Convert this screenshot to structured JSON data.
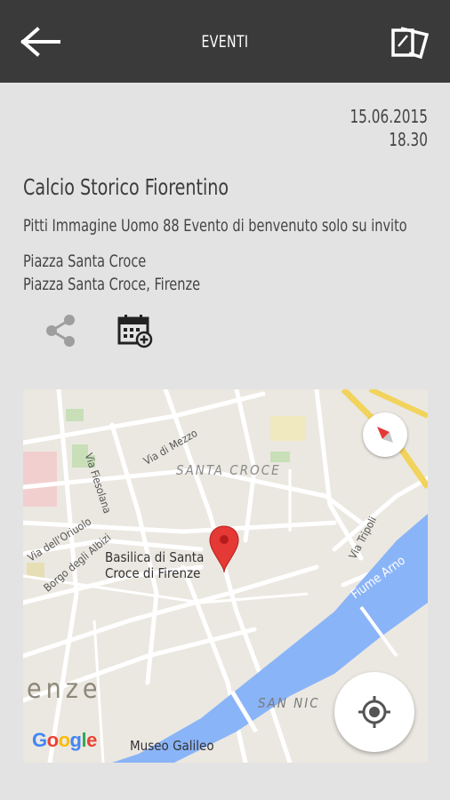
{
  "header": {
    "title": "EVENTI",
    "back_icon": "arrow-left-icon",
    "tickets_icon": "tickets-icon"
  },
  "event": {
    "date": "15.06.2015",
    "time": "18.30",
    "title": "Calcio Storico Fiorentino",
    "description": "Pitti Immagine Uomo 88 Evento di benvenuto solo su invito",
    "venue_name": "Piazza Santa Croce",
    "venue_address": "Piazza Santa Croce, Firenze"
  },
  "actions": {
    "share_icon": "share-icon",
    "calendar_icon": "calendar-add-icon"
  },
  "map": {
    "district_santa_croce": "SANTA CROCE",
    "district_san_nicolo": "SAN NIC",
    "city": "enze",
    "poi_line1": "Basilica di Santa",
    "poi_line2": "Croce di Firenze",
    "museum": "Museo Galileo",
    "river": "Fiume Arno",
    "streets": {
      "via_fiesolana": "Via Fiesolana",
      "via_di_mezzo": "Via di Mezzo",
      "via_dell_oriuolo": "Via dell'Oriuolo",
      "borgo_degli_albizi": "Borgo degli Albizi",
      "via_tripoli": "Via Tripoli"
    },
    "google": [
      "G",
      "o",
      "o",
      "g",
      "l",
      "e"
    ],
    "colors": {
      "water": "#8ab4f8",
      "land": "#ebe8e1",
      "pin": "#e53935",
      "highway": "#f2d35b"
    }
  }
}
